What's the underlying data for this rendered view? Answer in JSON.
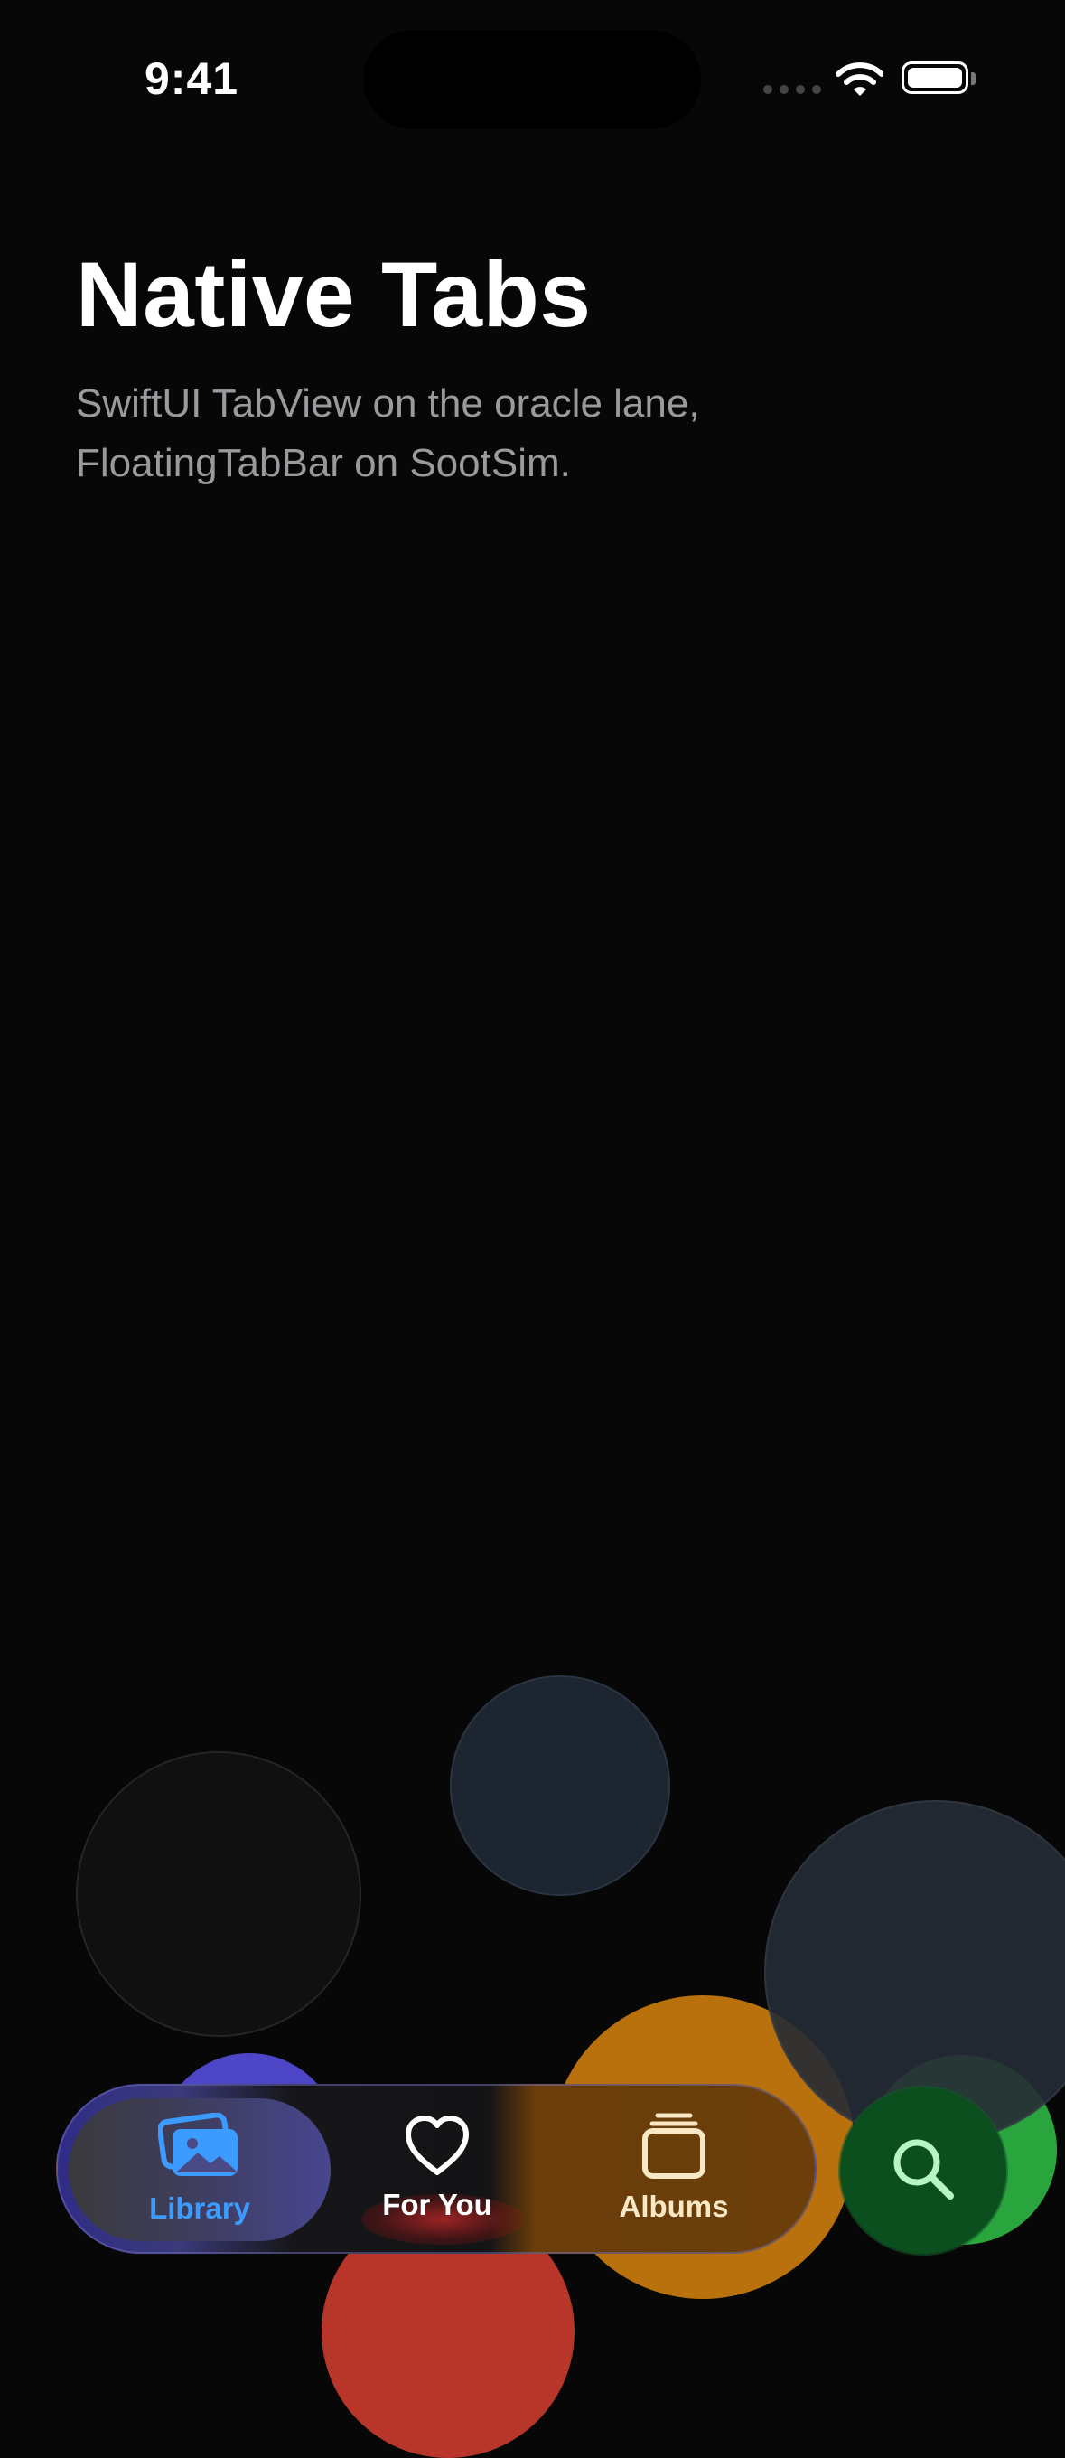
{
  "status_bar": {
    "time": "9:41"
  },
  "header": {
    "title": "Native Tabs",
    "subtitle": "SwiftUI TabView on the oracle lane, FloatingTabBar on SootSim."
  },
  "tab_bar": {
    "selected": "Library",
    "tabs": [
      {
        "label": "Library",
        "icon": "photo-stack-icon",
        "color": "#3b9bff"
      },
      {
        "label": "For You",
        "icon": "heart-icon",
        "color": "#ffffff"
      },
      {
        "label": "Albums",
        "icon": "albums-stack-icon",
        "color": "#f9e8c6"
      }
    ],
    "search": {
      "icon": "magnifier-icon"
    }
  },
  "colors": {
    "background": "#070707",
    "accent": "#3b9bff",
    "search_accent": "#0b4f1e",
    "subtitle": "#9a9a9e"
  }
}
